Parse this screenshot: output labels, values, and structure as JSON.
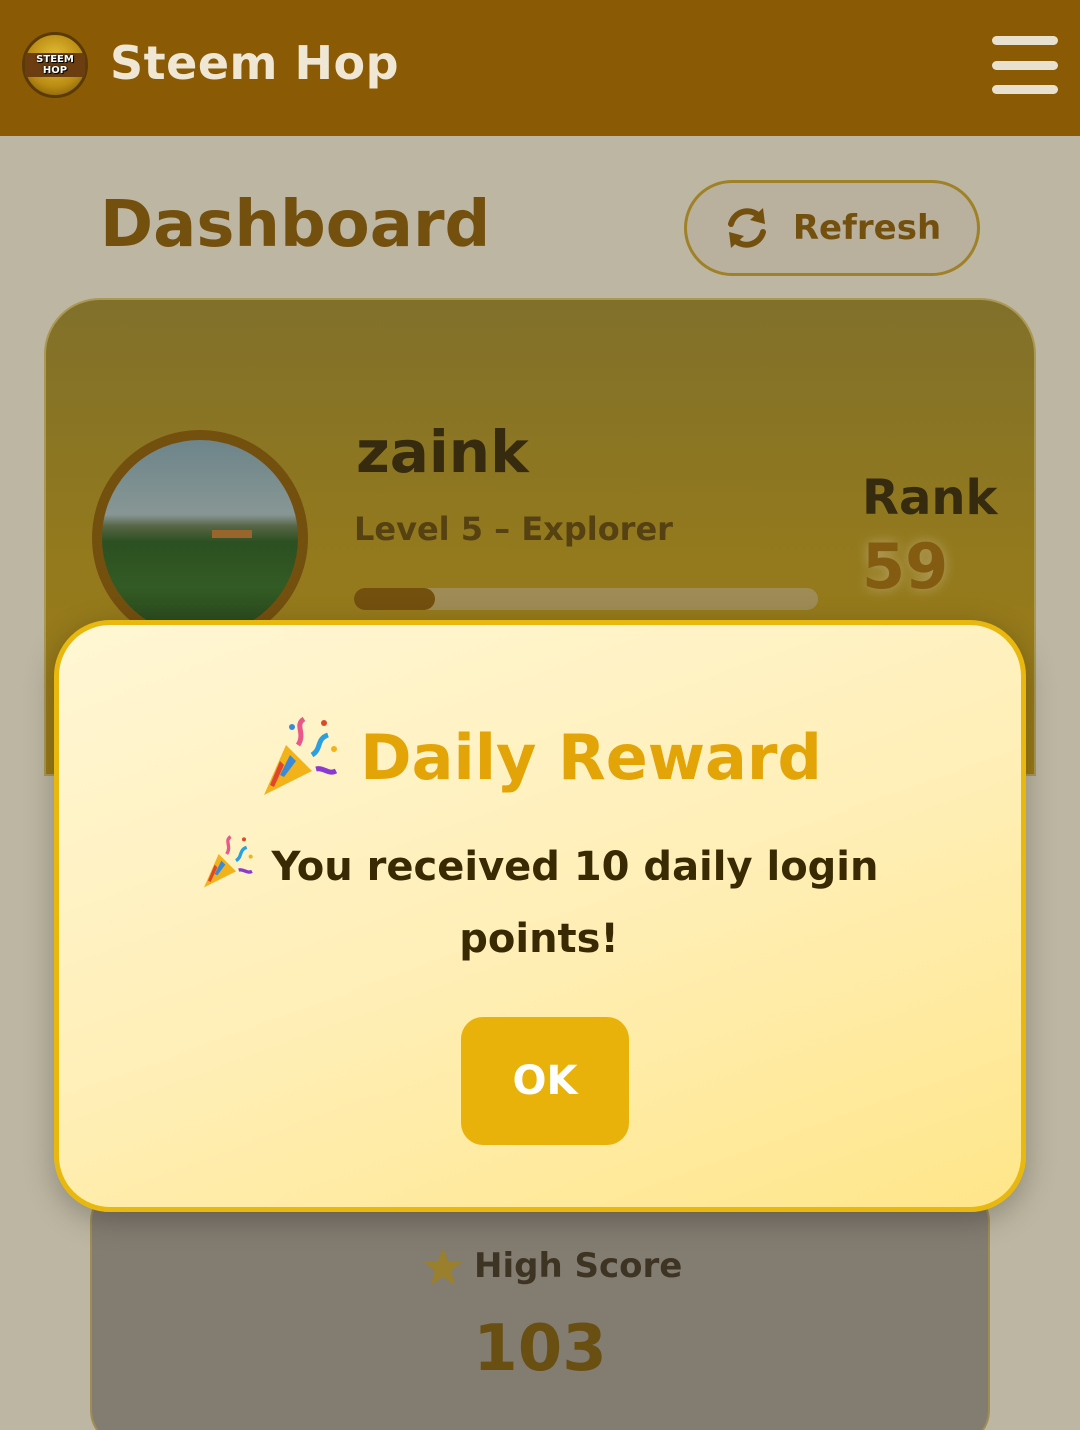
{
  "header": {
    "logo_text": "STEEM HOP",
    "app_title": "Steem Hop",
    "menu_icon": "hamburger-menu-icon"
  },
  "dashboard": {
    "title": "Dashboard",
    "refresh_label": "Refresh",
    "refresh_icon": "refresh-icon"
  },
  "profile": {
    "username": "zaink",
    "level": "Level 5 – Explorer",
    "level_progress_fraction": 0.175,
    "rank_label": "Rank",
    "rank_value": "59"
  },
  "stats": {
    "high_score_label": "High Score",
    "high_score_value": "103",
    "star_icon": "star-icon"
  },
  "modal": {
    "title": "Daily Reward",
    "message": "You received 10 daily login points!",
    "ok_label": "OK",
    "party_icon": "party-popper-icon"
  },
  "colors": {
    "header_bg": "#8a5a04",
    "accent": "#e8b20a",
    "title_gold": "#e3a408"
  }
}
